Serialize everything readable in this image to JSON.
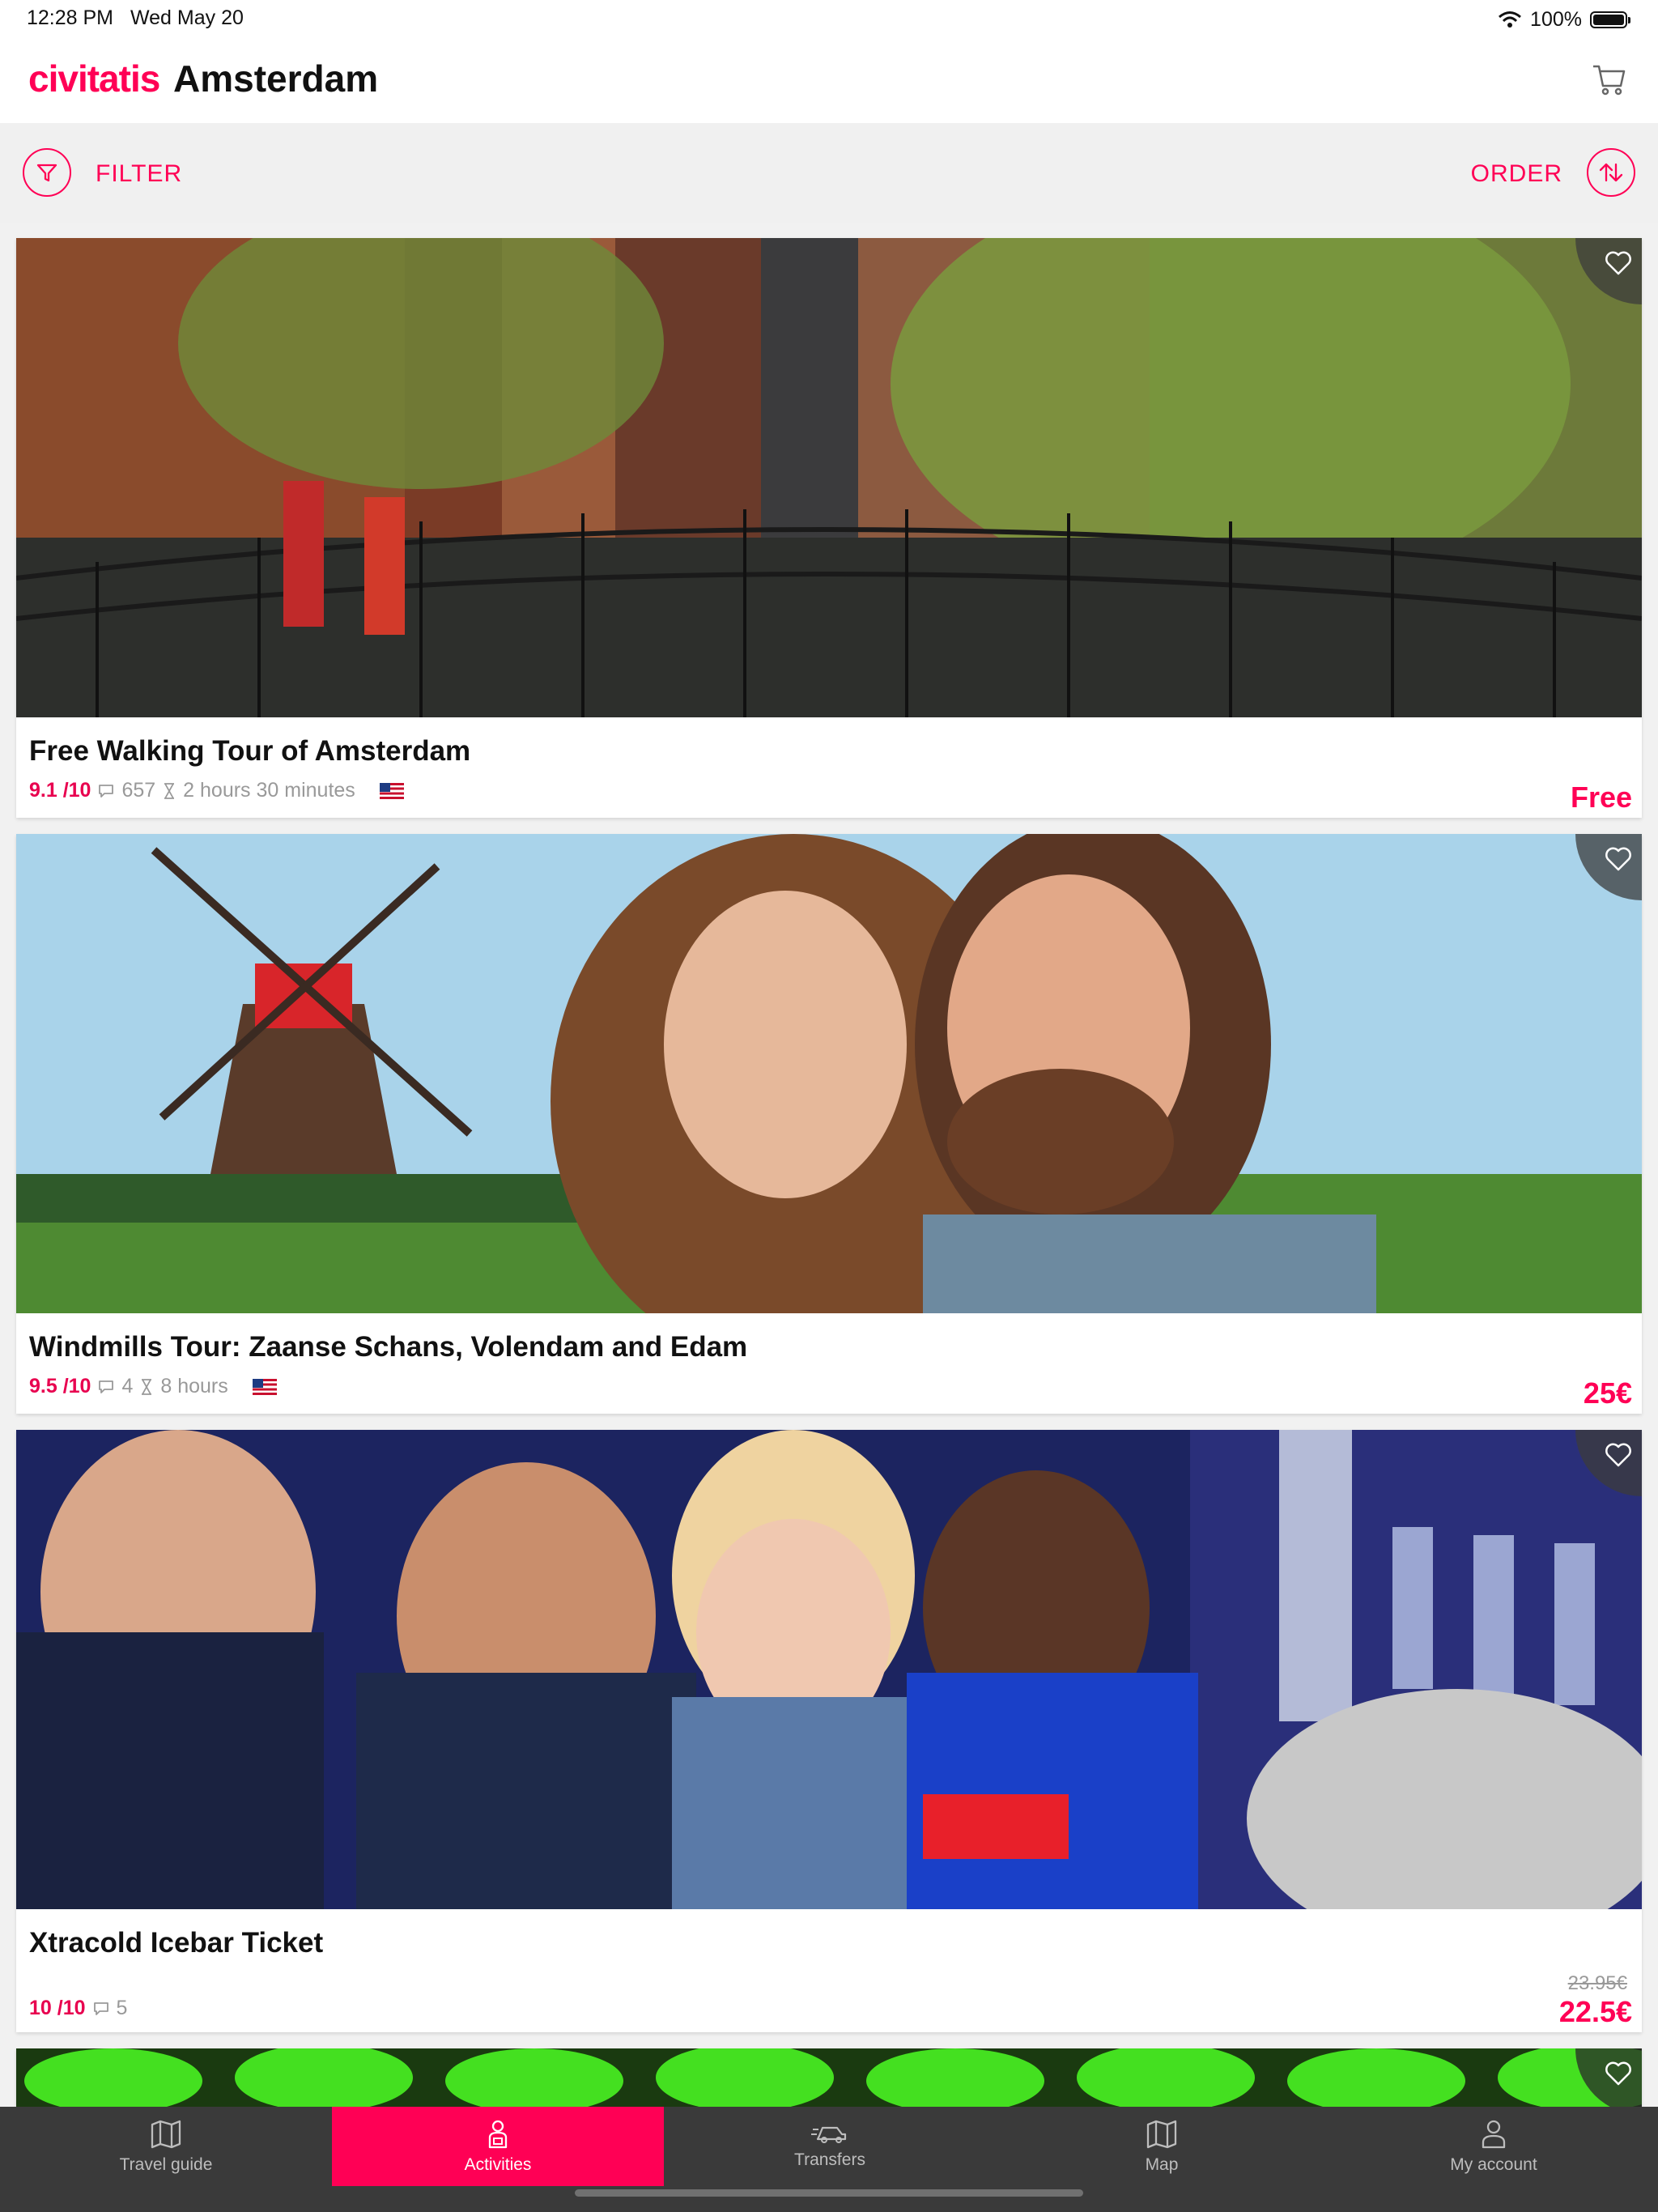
{
  "status_bar": {
    "time": "12:28 PM",
    "date": "Wed May 20",
    "battery": "100%"
  },
  "header": {
    "brand": "civitatis",
    "city": "Amsterdam"
  },
  "toolbar": {
    "filter_label": "FILTER",
    "order_label": "ORDER"
  },
  "activities": [
    {
      "title": "Free Walking Tour of Amsterdam",
      "rating": "9.1 /10",
      "reviews": "657",
      "duration": "2 hours 30 minutes",
      "price": "Free"
    },
    {
      "title": "Windmills Tour: Zaanse Schans, Volendam and Edam",
      "rating": "9.5 /10",
      "reviews": "4",
      "duration": "8 hours",
      "price": "25€"
    },
    {
      "title": "Xtracold Icebar Ticket",
      "rating": "10 /10",
      "reviews": "5",
      "old_price": "23.95€",
      "price": "22.5€"
    }
  ],
  "tabs": [
    {
      "label": "Travel guide",
      "icon": "travel-guide-map-icon"
    },
    {
      "label": "Activities",
      "icon": "activities-person-icon",
      "active": true
    },
    {
      "label": "Transfers",
      "icon": "transfers-car-icon"
    },
    {
      "label": "Map",
      "icon": "map-icon"
    },
    {
      "label": "My account",
      "icon": "user-icon"
    }
  ],
  "colors": {
    "accent": "#ff0055",
    "tabbar": "#3a3a3a",
    "toolbar_bg": "#f0f0f0"
  }
}
